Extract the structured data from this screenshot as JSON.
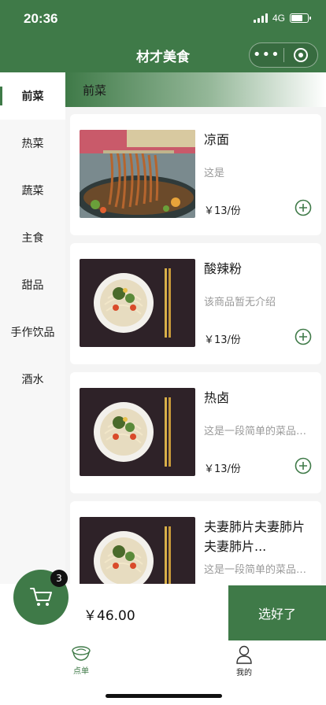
{
  "status_bar": {
    "time": "20:36",
    "network": "4G"
  },
  "nav": {
    "title": "材才美食",
    "more_icon": "more-dots-icon",
    "close_icon": "target-ring-icon"
  },
  "categories": [
    {
      "label": "前菜",
      "active": true
    },
    {
      "label": "热菜",
      "active": false
    },
    {
      "label": "蔬菜",
      "active": false
    },
    {
      "label": "主食",
      "active": false
    },
    {
      "label": "甜品",
      "active": false
    },
    {
      "label": "手作饮品",
      "active": false
    },
    {
      "label": "酒水",
      "active": false
    }
  ],
  "section": {
    "title": "前菜"
  },
  "dishes": [
    {
      "name": "凉面",
      "desc": "这是",
      "price": "￥13/份",
      "image": "noodles-lifted-photo"
    },
    {
      "name": "酸辣粉",
      "desc": "该商品暂无介绍",
      "price": "￥13/份",
      "image": "noodle-bowl-photo"
    },
    {
      "name": "热卤",
      "desc": "这是一段简单的菜品描述",
      "price": "￥13/份",
      "image": "noodle-bowl-photo"
    },
    {
      "name": "夫妻肺片夫妻肺片夫妻肺片...",
      "desc": "这是一段简单的菜品描述",
      "price": "",
      "image": "noodle-bowl-photo"
    }
  ],
  "cart": {
    "count": "3",
    "total": "￥46.00",
    "checkout_label": "选好了"
  },
  "tabbar": [
    {
      "label": "点单",
      "icon": "bowl-icon",
      "active": true
    },
    {
      "label": "我的",
      "icon": "user-icon",
      "active": false
    }
  ],
  "colors": {
    "brand": "#3f7a48",
    "price_text": "#222222",
    "desc_text": "#9a9a9a"
  }
}
